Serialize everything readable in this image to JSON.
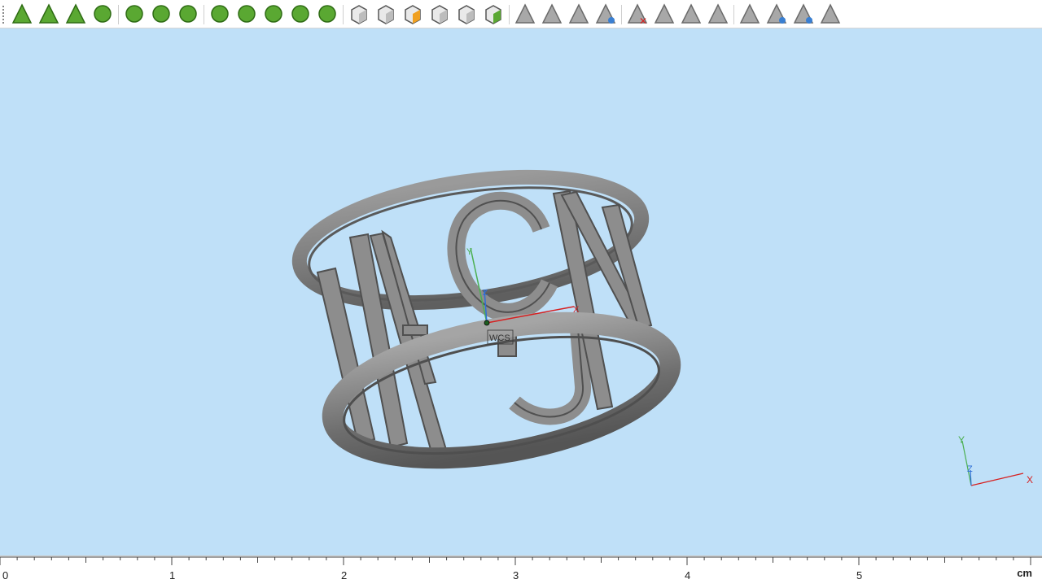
{
  "toolbar": {
    "groups": [
      [
        "select-icon",
        "face-select-icon",
        "edge-select-icon",
        "sphere-select-icon"
      ],
      [
        "rect-select-icon",
        "blob-select-icon",
        "curve-select-icon"
      ],
      [
        "mesh-select-icon",
        "shape-icon",
        "gear-shape-icon",
        "wheel-icon",
        "star-wheel-icon"
      ],
      [
        "box-icon",
        "box-select-icon",
        "box-color-icon",
        "box-outline-icon",
        "box-render-icon",
        "box-green-icon"
      ],
      [
        "triangle-icon",
        "triangle-edit-icon",
        "triangle-arrow-icon",
        "triangle-blue-icon"
      ],
      [
        "triangle-delete-icon",
        "triangle-hatch-icon",
        "triangle-copy-icon",
        "triangle-slice-icon"
      ],
      [
        "triangle-eye-icon",
        "triangle-wave-icon",
        "triangle-blue-dot-icon",
        "triangle-flat-icon"
      ]
    ]
  },
  "viewport": {
    "wcs_label": "WCS",
    "axis_x": "X",
    "axis_y": "Y",
    "axis_z": "Z",
    "colors": {
      "background": "#bfe0f8",
      "x_axis": "#d62020",
      "y_axis": "#4caf50",
      "z_axis": "#2f6fd6",
      "model": "#7a7a7a"
    }
  },
  "ruler": {
    "labels": [
      "0",
      "1",
      "2",
      "3",
      "4",
      "5"
    ],
    "unit": "cm"
  }
}
